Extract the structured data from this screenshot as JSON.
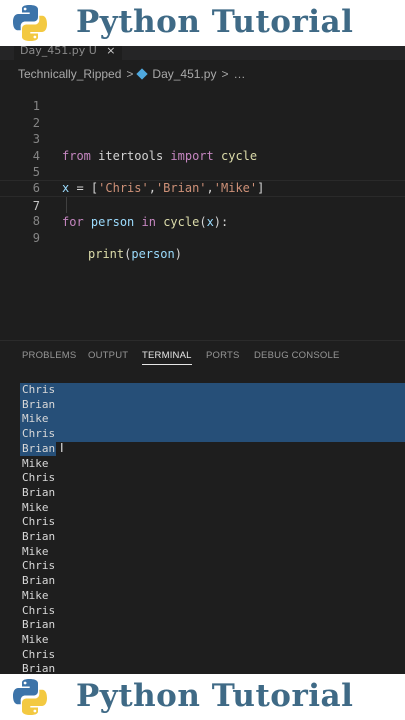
{
  "banner": {
    "title": "Python Tutorial",
    "logo": "python-logo"
  },
  "editor_tab": {
    "label": "Day_451.py",
    "modified_marker": "U",
    "close_glyph": "×"
  },
  "breadcrumb": {
    "folder": "Technically_Ripped",
    "file": "Day_451.py",
    "ellipsis": "…",
    "separator": ">"
  },
  "line_numbers": [
    "1",
    "2",
    "3",
    "4",
    "5",
    "6",
    "7",
    "8",
    "9"
  ],
  "code": {
    "line3": {
      "from": "from",
      "module": "itertools",
      "import": "import",
      "name": "cycle"
    },
    "line5": {
      "var": "x",
      "eq": " = [",
      "s1": "'Chris'",
      "c1": ",",
      "s2": "'Brian'",
      "c2": ",",
      "s3": "'Mike'",
      "end": "]"
    },
    "line7": {
      "for": "for",
      "var": "person",
      "in": "in",
      "fn": "cycle",
      "open": "(",
      "arg": "x",
      "close": "):"
    },
    "line8": {
      "fn": "print",
      "open": "(",
      "arg": "person",
      "close": ")"
    }
  },
  "panel_tabs": [
    "PROBLEMS",
    "OUTPUT",
    "TERMINAL",
    "PORTS",
    "DEBUG CONSOLE"
  ],
  "active_panel_tab": "TERMINAL",
  "terminal_lines": [
    "Chris",
    "Brian",
    "Mike",
    "Chris",
    "Brian",
    "Mike",
    "Chris",
    "Brian",
    "Mike",
    "Chris",
    "Brian",
    "Mike",
    "Chris",
    "Brian",
    "Mike",
    "Chris",
    "Brian",
    "Mike",
    "Chris",
    "Brian"
  ],
  "colors": {
    "accent_title": "#3f6a86",
    "editor_bg": "#1e1e1e",
    "selection": "#264f78"
  }
}
